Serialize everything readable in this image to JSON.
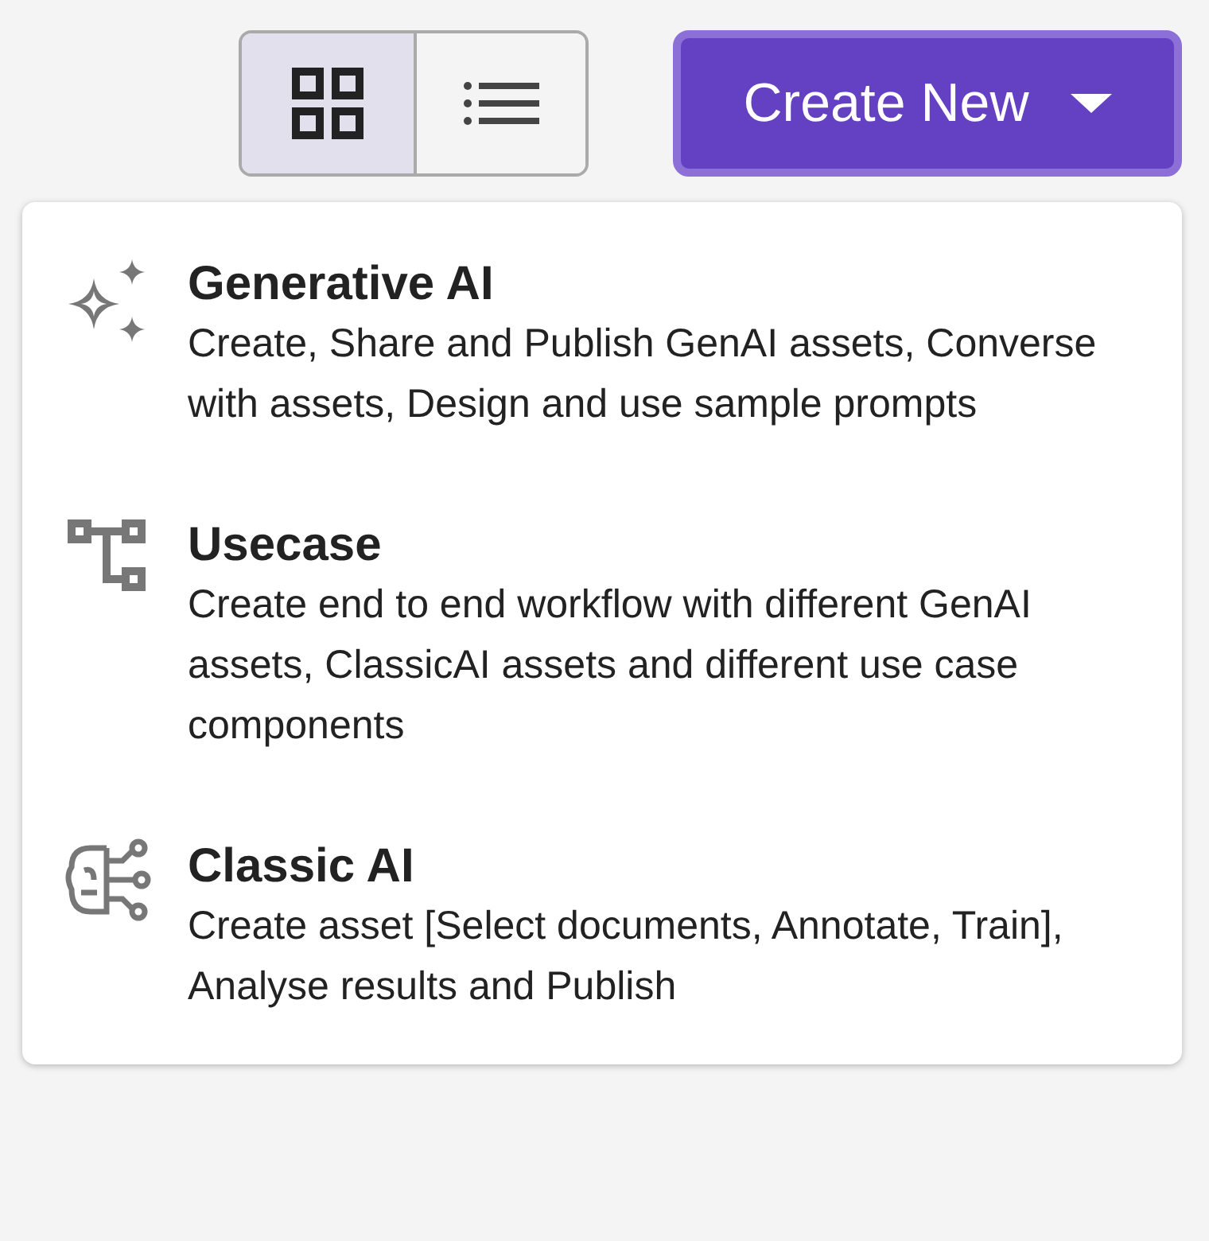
{
  "view_toggle": [
    {
      "kind": "grid",
      "selected": true
    },
    {
      "kind": "list",
      "selected": false
    }
  ],
  "create_button": {
    "label": "Create New",
    "expanded": true
  },
  "menu": {
    "items": [
      {
        "kind": "sparkle",
        "title": "Generative AI",
        "description": "Create, Share and Publish GenAI assets, Converse with assets, Design and use sample prompts"
      },
      {
        "kind": "flow",
        "title": "Usecase",
        "description": "Create end to end workflow with different GenAI assets, ClassicAI assets and different use case components"
      },
      {
        "kind": "brain",
        "title": "Classic AI",
        "description": "Create asset [Select documents, Annotate, Train], Analyse results and Publish"
      }
    ]
  }
}
